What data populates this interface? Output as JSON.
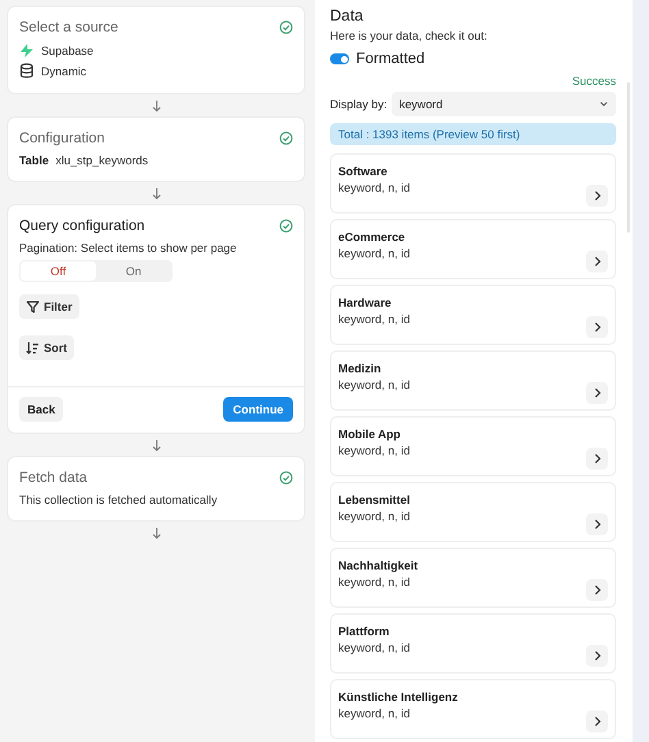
{
  "steps": [
    {
      "kind": "source",
      "title": "Select a source",
      "active": false,
      "done": true,
      "sources": [
        {
          "kind": "bolt",
          "label": "Supabase"
        },
        {
          "kind": "database",
          "label": "Dynamic"
        }
      ]
    },
    {
      "kind": "table",
      "title": "Configuration",
      "active": false,
      "done": true,
      "table_label": "Table",
      "table_value": "xlu_stp_keywords"
    },
    {
      "kind": "query",
      "title": "Query configuration",
      "active": true,
      "done": true,
      "pagination_label": "Pagination: Select items to show per page",
      "pagination_options": [
        {
          "label": "Off",
          "selected": true
        },
        {
          "label": "On",
          "selected": false
        }
      ],
      "tools": [
        {
          "kind": "filter",
          "label": "Filter"
        },
        {
          "kind": "sort",
          "label": "Sort"
        }
      ],
      "back": "Back",
      "continue": "Continue"
    },
    {
      "kind": "fetch",
      "title": "Fetch data",
      "active": false,
      "done": true,
      "description": "This collection is fetched automatically"
    }
  ],
  "data": {
    "title": "Data",
    "subtitle": "Here is your data, check it out:",
    "formatted": {
      "label": "Formatted",
      "on": true
    },
    "status": "Success",
    "display_by": {
      "label": "Display by:",
      "value": "keyword"
    },
    "total": "Total : 1393 items (Preview 50 first)",
    "items": [
      {
        "title": "Software",
        "fields": "keyword, n, id"
      },
      {
        "title": "eCommerce",
        "fields": "keyword, n, id"
      },
      {
        "title": "Hardware",
        "fields": "keyword, n, id"
      },
      {
        "title": "Medizin",
        "fields": "keyword, n, id"
      },
      {
        "title": "Mobile App",
        "fields": "keyword, n, id"
      },
      {
        "title": "Lebensmittel",
        "fields": "keyword, n, id"
      },
      {
        "title": "Nachhaltigkeit",
        "fields": "keyword, n, id"
      },
      {
        "title": "Plattform",
        "fields": "keyword, n, id"
      },
      {
        "title": "Künstliche Intelligenz",
        "fields": "keyword, n, id"
      }
    ]
  }
}
